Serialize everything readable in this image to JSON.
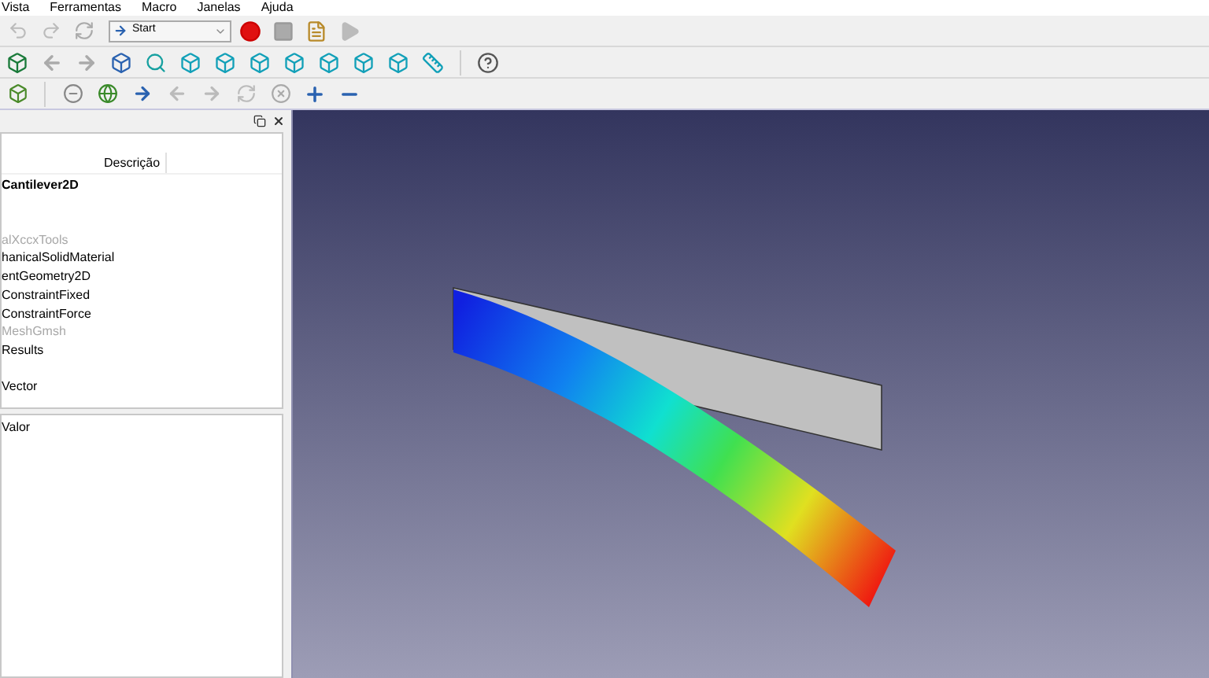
{
  "menu_bar": {
    "items": [
      "Vista",
      "Ferramentas",
      "Macro",
      "Janelas",
      "Ajuda"
    ]
  },
  "macro_toolbar": {
    "workbench_selector": {
      "value": "Start"
    }
  },
  "tree_view": {
    "columns": [
      "Descrição"
    ],
    "items": [
      {
        "label": "Cantilever2D",
        "kind": "document",
        "disabled": false
      },
      {
        "label": "alXccxTools",
        "kind": "object",
        "disabled": true
      },
      {
        "label": "hanicalSolidMaterial",
        "kind": "object",
        "disabled": false
      },
      {
        "label": "entGeometry2D",
        "kind": "object",
        "disabled": false
      },
      {
        "label": "ConstraintFixed",
        "kind": "object",
        "disabled": false
      },
      {
        "label": "ConstraintForce",
        "kind": "object",
        "disabled": false
      },
      {
        "label": "MeshGmsh",
        "kind": "object",
        "disabled": true
      },
      {
        "label": "Results",
        "kind": "object",
        "disabled": false
      },
      {
        "label": "Vector",
        "kind": "object",
        "disabled": false
      }
    ]
  },
  "property_view": {
    "columns": [
      "Valor"
    ]
  }
}
